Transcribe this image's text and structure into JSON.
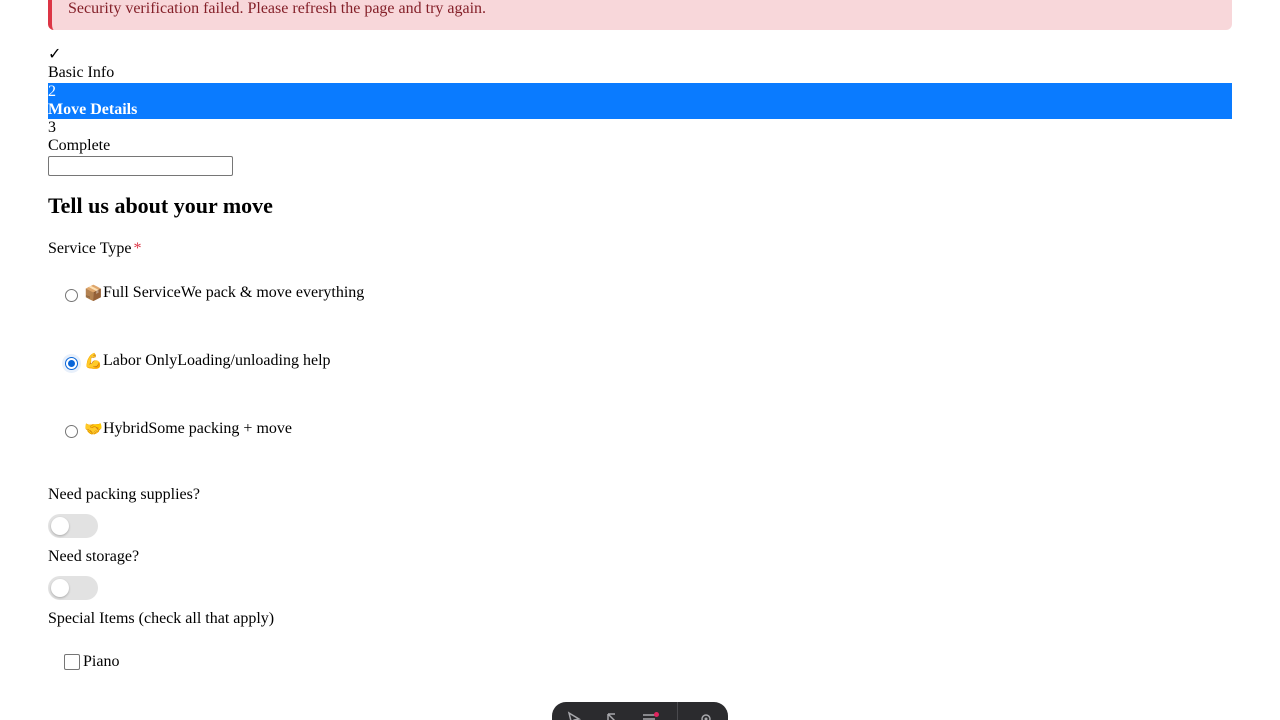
{
  "alert": {
    "message": "Security verification failed. Please refresh the page and try again."
  },
  "steps": [
    {
      "number": "✓",
      "label": "Basic Info",
      "state": "completed"
    },
    {
      "number": "2",
      "label": "Move Details",
      "state": "active"
    },
    {
      "number": "3",
      "label": "Complete",
      "state": "upcoming"
    }
  ],
  "form": {
    "title": "Tell us about your move",
    "service_type_label": "Service Type",
    "required_marker": "*",
    "service_options": [
      {
        "icon": "📦",
        "icon_name": "package-icon",
        "title": "Full Service",
        "description": "We pack & move everything",
        "selected": false
      },
      {
        "icon": "💪",
        "icon_name": "flexed-biceps-icon",
        "title": "Labor Only",
        "description": "Loading/unloading help",
        "selected": true
      },
      {
        "icon": "🤝",
        "icon_name": "handshake-icon",
        "title": "Hybrid",
        "description": "Some packing + move",
        "selected": false
      }
    ],
    "packing_supplies_label": "Need packing supplies?",
    "packing_supplies_on": false,
    "storage_label": "Need storage?",
    "storage_on": false,
    "special_items_label": "Special Items (check all that apply)",
    "special_items": [
      {
        "label": "Piano",
        "checked": false
      }
    ]
  },
  "dock": {
    "icons": [
      "inspector-icon",
      "cursor-icon",
      "menu-icon",
      "settings-icon"
    ]
  },
  "colors": {
    "alert_bg": "#f8d7da",
    "alert_border": "#dc3545",
    "alert_text": "#842029",
    "active_step_bg": "#0a7bff",
    "required": "#dc3545",
    "radio_checked": "#0a66d8",
    "toggle_off": "#e2e2e2",
    "dock_bg": "#2b2b2e"
  }
}
